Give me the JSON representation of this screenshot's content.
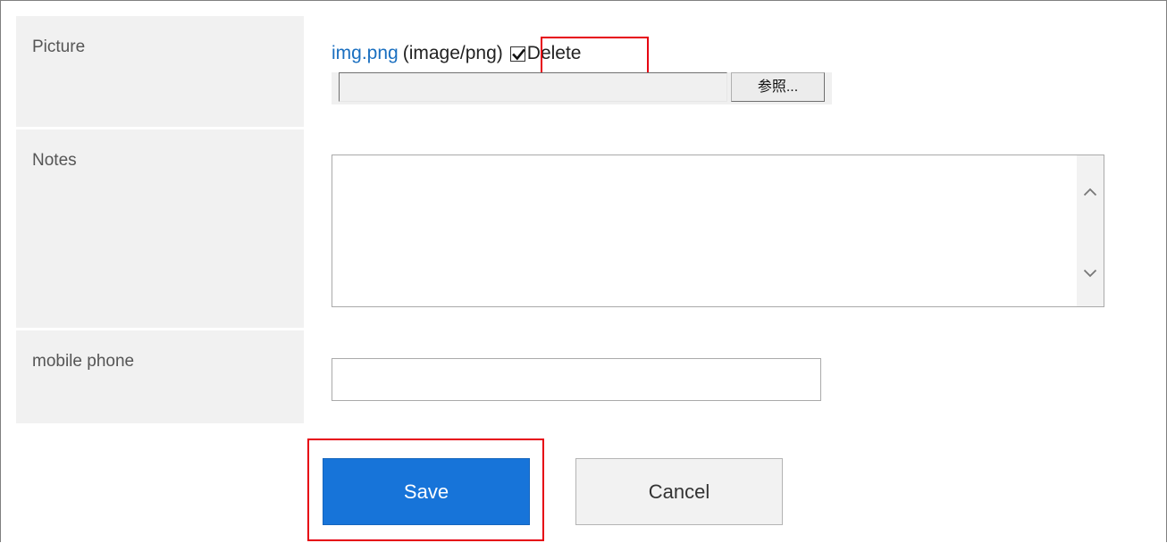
{
  "form": {
    "picture": {
      "label": "Picture",
      "file_name": "img.png",
      "file_type": "(image/png)",
      "delete_label": "Delete",
      "delete_checked": true,
      "file_input_value": "",
      "browse_label": "参照..."
    },
    "notes": {
      "label": "Notes",
      "value": ""
    },
    "mobile_phone": {
      "label": "mobile phone",
      "value": ""
    }
  },
  "actions": {
    "save_label": "Save",
    "cancel_label": "Cancel"
  },
  "colors": {
    "accent": "#1774d9",
    "link": "#1a6fc0",
    "highlight": "#e60012",
    "label_background": "#f1f1f1"
  }
}
